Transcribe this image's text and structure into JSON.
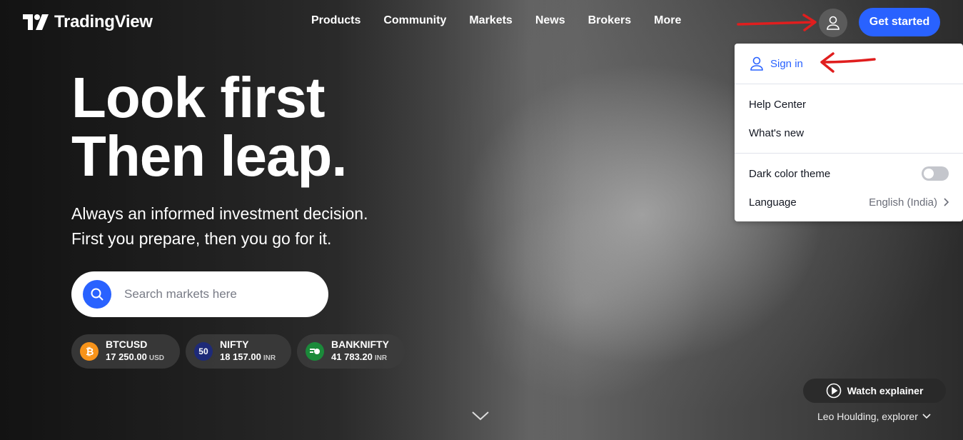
{
  "header": {
    "brand": "TradingView",
    "nav": [
      "Products",
      "Community",
      "Markets",
      "News",
      "Brokers",
      "More"
    ],
    "cta": "Get started"
  },
  "hero": {
    "headline": [
      "Look first",
      "Then leap."
    ],
    "subline": [
      "Always an informed investment decision.",
      "First you prepare, then you go for it."
    ],
    "search_placeholder": "Search markets here"
  },
  "tickers": [
    {
      "symbol": "BTCUSD",
      "value": "17 250.00",
      "currency": "USD",
      "icon": "bitcoin-icon",
      "color": "#f7931a"
    },
    {
      "symbol": "NIFTY",
      "value": "18 157.00",
      "currency": "INR",
      "icon": "nifty-50-icon",
      "icon_text": "50",
      "color": "#1e2a78"
    },
    {
      "symbol": "BANKNIFTY",
      "value": "41 783.20",
      "currency": "INR",
      "icon": "banknifty-icon",
      "color": "#1b8a3a"
    }
  ],
  "menu": {
    "sign_in": "Sign in",
    "help_center": "Help Center",
    "whats_new": "What's new",
    "dark_theme": "Dark color theme",
    "dark_theme_on": false,
    "language_label": "Language",
    "language_value": "English (India)"
  },
  "bottom": {
    "watch": "Watch explainer",
    "credit": "Leo Houlding, explorer"
  },
  "colors": {
    "accent": "#2962ff",
    "annotation": "#e01e1e"
  }
}
